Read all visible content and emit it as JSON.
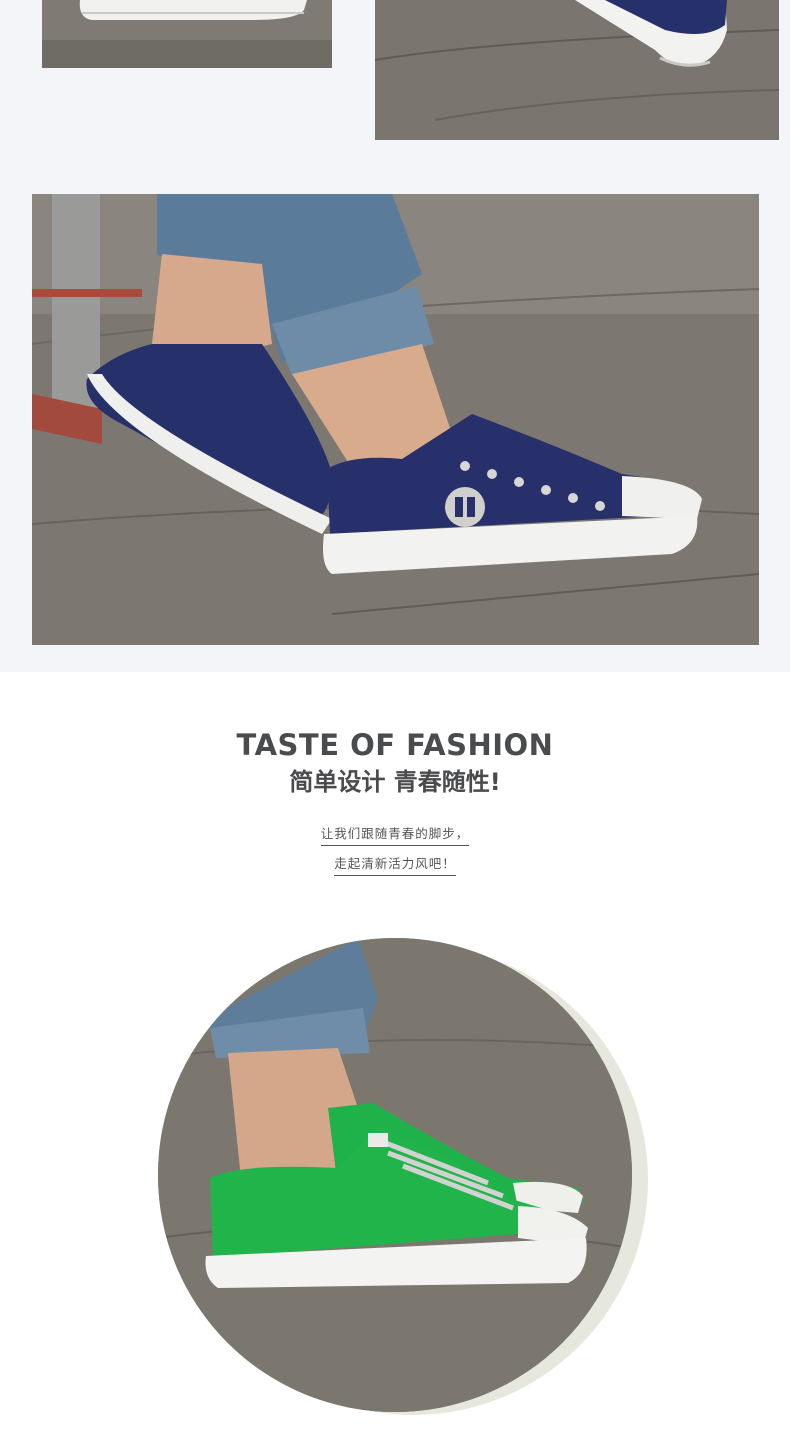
{
  "heading": "TASTE OF FASHION",
  "subheading": "简单设计 青春随性!",
  "lines": [
    "让我们跟随青春的脚步，",
    "走起清新活力风吧！"
  ],
  "colors": {
    "band": "#f3f5f9",
    "heading_text": "#4a4b4d",
    "navy_shoe": "#25306a",
    "green_shoe": "#1fb24a",
    "circle_shadow": "#e6e8de"
  },
  "images": [
    {
      "name": "navy-shoe-detail-left",
      "content": "navy canvas sneaker toe on pavement"
    },
    {
      "name": "navy-shoe-detail-right",
      "content": "navy canvas sneaker heel on pavement"
    },
    {
      "name": "navy-shoes-worn",
      "content": "legs in rolled jeans wearing navy low-top canvas sneakers"
    },
    {
      "name": "green-shoes-circle",
      "content": "legs in rolled jeans wearing green low-top canvas sneakers"
    }
  ]
}
